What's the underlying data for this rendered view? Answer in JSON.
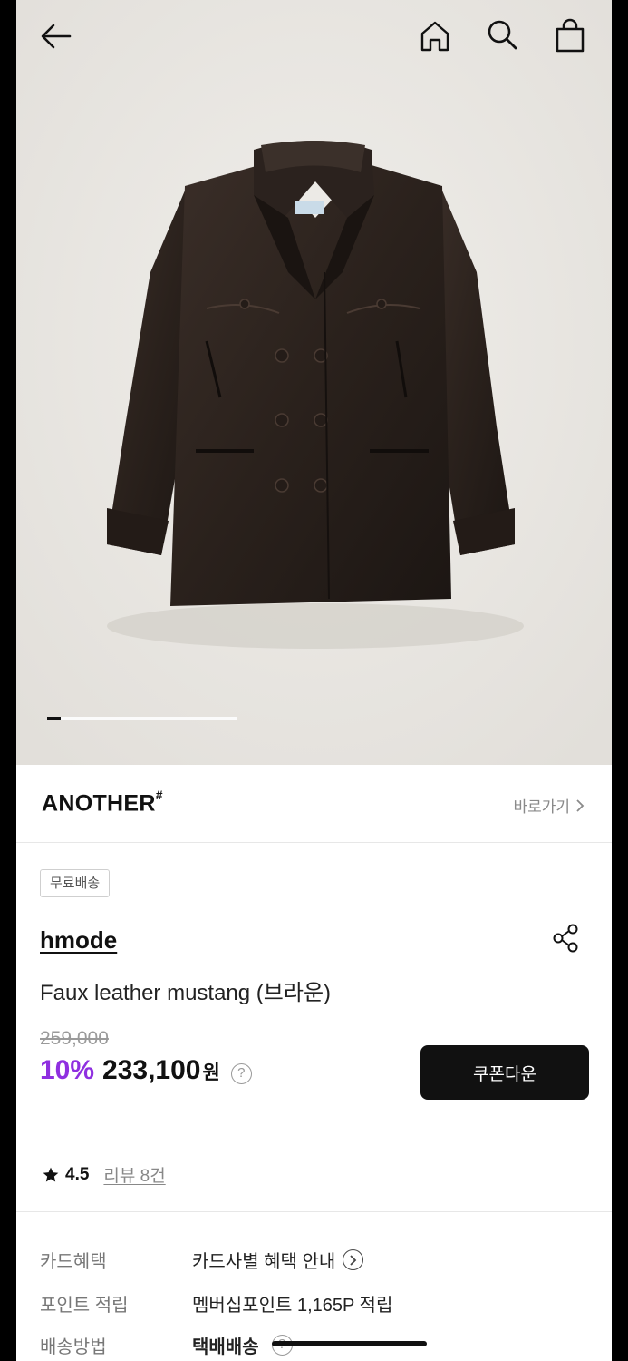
{
  "header": {
    "back_icon": "arrow-left-icon",
    "home_icon": "home-icon",
    "search_icon": "search-icon",
    "cart_icon": "shopping-bag-icon"
  },
  "gallery": {
    "image_subject": "dark brown faux leather double-breasted jacket with fur collar",
    "progress": 0.07
  },
  "brand": {
    "name": "ANOTHER",
    "mark": "#",
    "link_label": "바로가기"
  },
  "product": {
    "badge": "무료배송",
    "seller": "hmode",
    "title": "Faux leather mustang (브라운)",
    "original_price": "259,000",
    "discount": "10%",
    "price": "233,100",
    "currency": "원",
    "help": "?",
    "coupon_button": "쿠폰다운",
    "rating": "4.5",
    "review_link": "리뷰 8건"
  },
  "info": [
    {
      "label": "카드혜택",
      "value": "카드사별 혜택 안내"
    },
    {
      "label": "포인트 적립",
      "value": "멤버십포인트 1,165P 적립"
    },
    {
      "label": "배송방법",
      "value": "택배배송"
    }
  ],
  "colors": {
    "accent_purple": "#8f2fe0",
    "button_black": "#111111",
    "hero_bg": "#e9e6e2"
  }
}
